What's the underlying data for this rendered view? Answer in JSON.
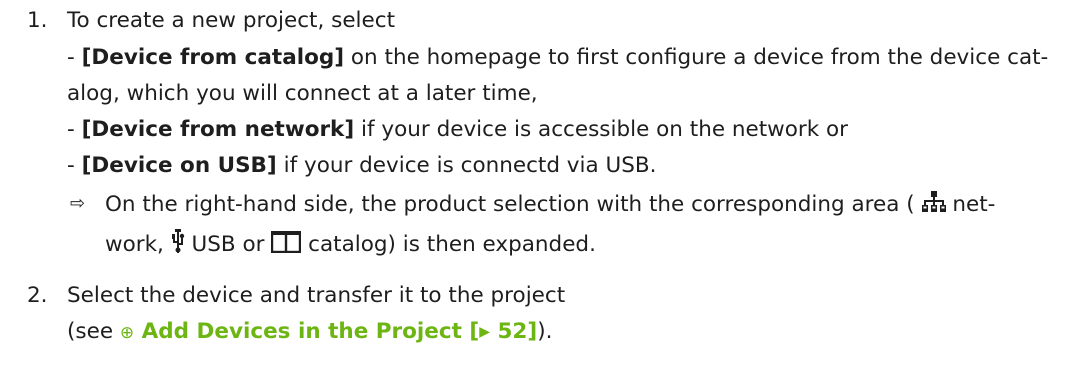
{
  "steps": [
    {
      "number": "1.",
      "intro": "To create a new project, select",
      "options": [
        {
          "prefix": "- ",
          "label": "[Device from catalog]",
          "text_1": " on the homepage to first configure a device from the device cat-",
          "text_2": "alog, which you will connect at a later time,"
        },
        {
          "prefix": "- ",
          "label": "[Device from network]",
          "text_1": " if your device is accessible on the network or"
        },
        {
          "prefix": "- ",
          "label": "[Device on USB]",
          "text_1": " if your device is connectd via USB."
        }
      ],
      "result": {
        "arrow": "⇨",
        "line1_a": "On the right-hand side, the product selection with the corresponding area (",
        "line1_b": " net-",
        "line2_a": "work, ",
        "line2_b": " USB or ",
        "line2_c": " catalog) is then expanded.",
        "icons": [
          "network-icon",
          "usb-icon",
          "catalog-icon"
        ]
      }
    },
    {
      "number": "2.",
      "line1": "Select the device and transfer it to the project",
      "line2_a": "(see ",
      "link_icon": "⊕",
      "link_text": "Add Devices in the Project [▸ 52]",
      "line2_b": ")."
    }
  ],
  "colors": {
    "text": "#1e1e1e",
    "link": "#6cb512"
  }
}
